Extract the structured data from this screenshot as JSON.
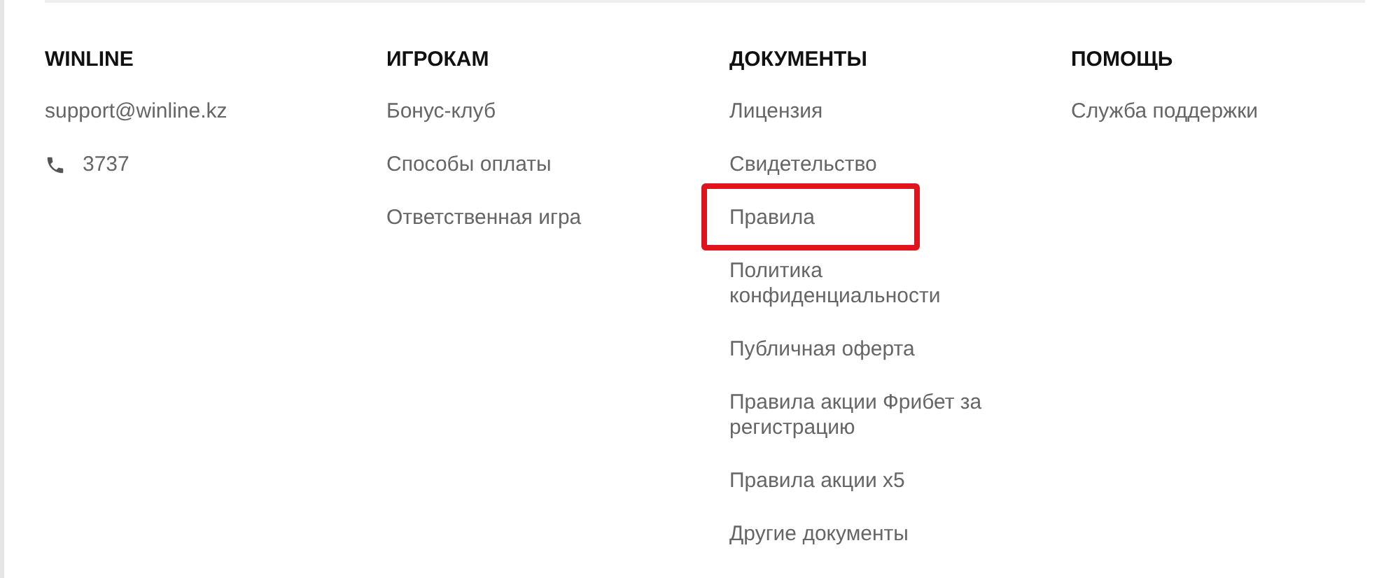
{
  "columns": [
    {
      "kind": "contacts",
      "heading": "WINLINE",
      "email": "support@winline.kz",
      "phone": "3737"
    },
    {
      "kind": "links",
      "heading": "ИГРОКАМ",
      "links": [
        {
          "label": "Бонус-клуб",
          "highlighted": false
        },
        {
          "label": "Способы оплаты",
          "highlighted": false
        },
        {
          "label": "Ответственная игра",
          "highlighted": false
        }
      ]
    },
    {
      "kind": "links",
      "heading": "ДОКУМЕНТЫ",
      "links": [
        {
          "label": "Лицензия",
          "highlighted": false
        },
        {
          "label": "Свидетельство",
          "highlighted": false
        },
        {
          "label": "Правила",
          "highlighted": true
        },
        {
          "label": "Политика конфиденциальности",
          "highlighted": false
        },
        {
          "label": "Публичная оферта",
          "highlighted": false
        },
        {
          "label": "Правила акции Фрибет за регистрацию",
          "highlighted": false
        },
        {
          "label": "Правила акции x5",
          "highlighted": false
        },
        {
          "label": "Другие документы",
          "highlighted": false
        }
      ]
    },
    {
      "kind": "links",
      "heading": "ПОМОЩЬ",
      "links": [
        {
          "label": "Служба поддержки",
          "highlighted": false
        }
      ]
    }
  ]
}
